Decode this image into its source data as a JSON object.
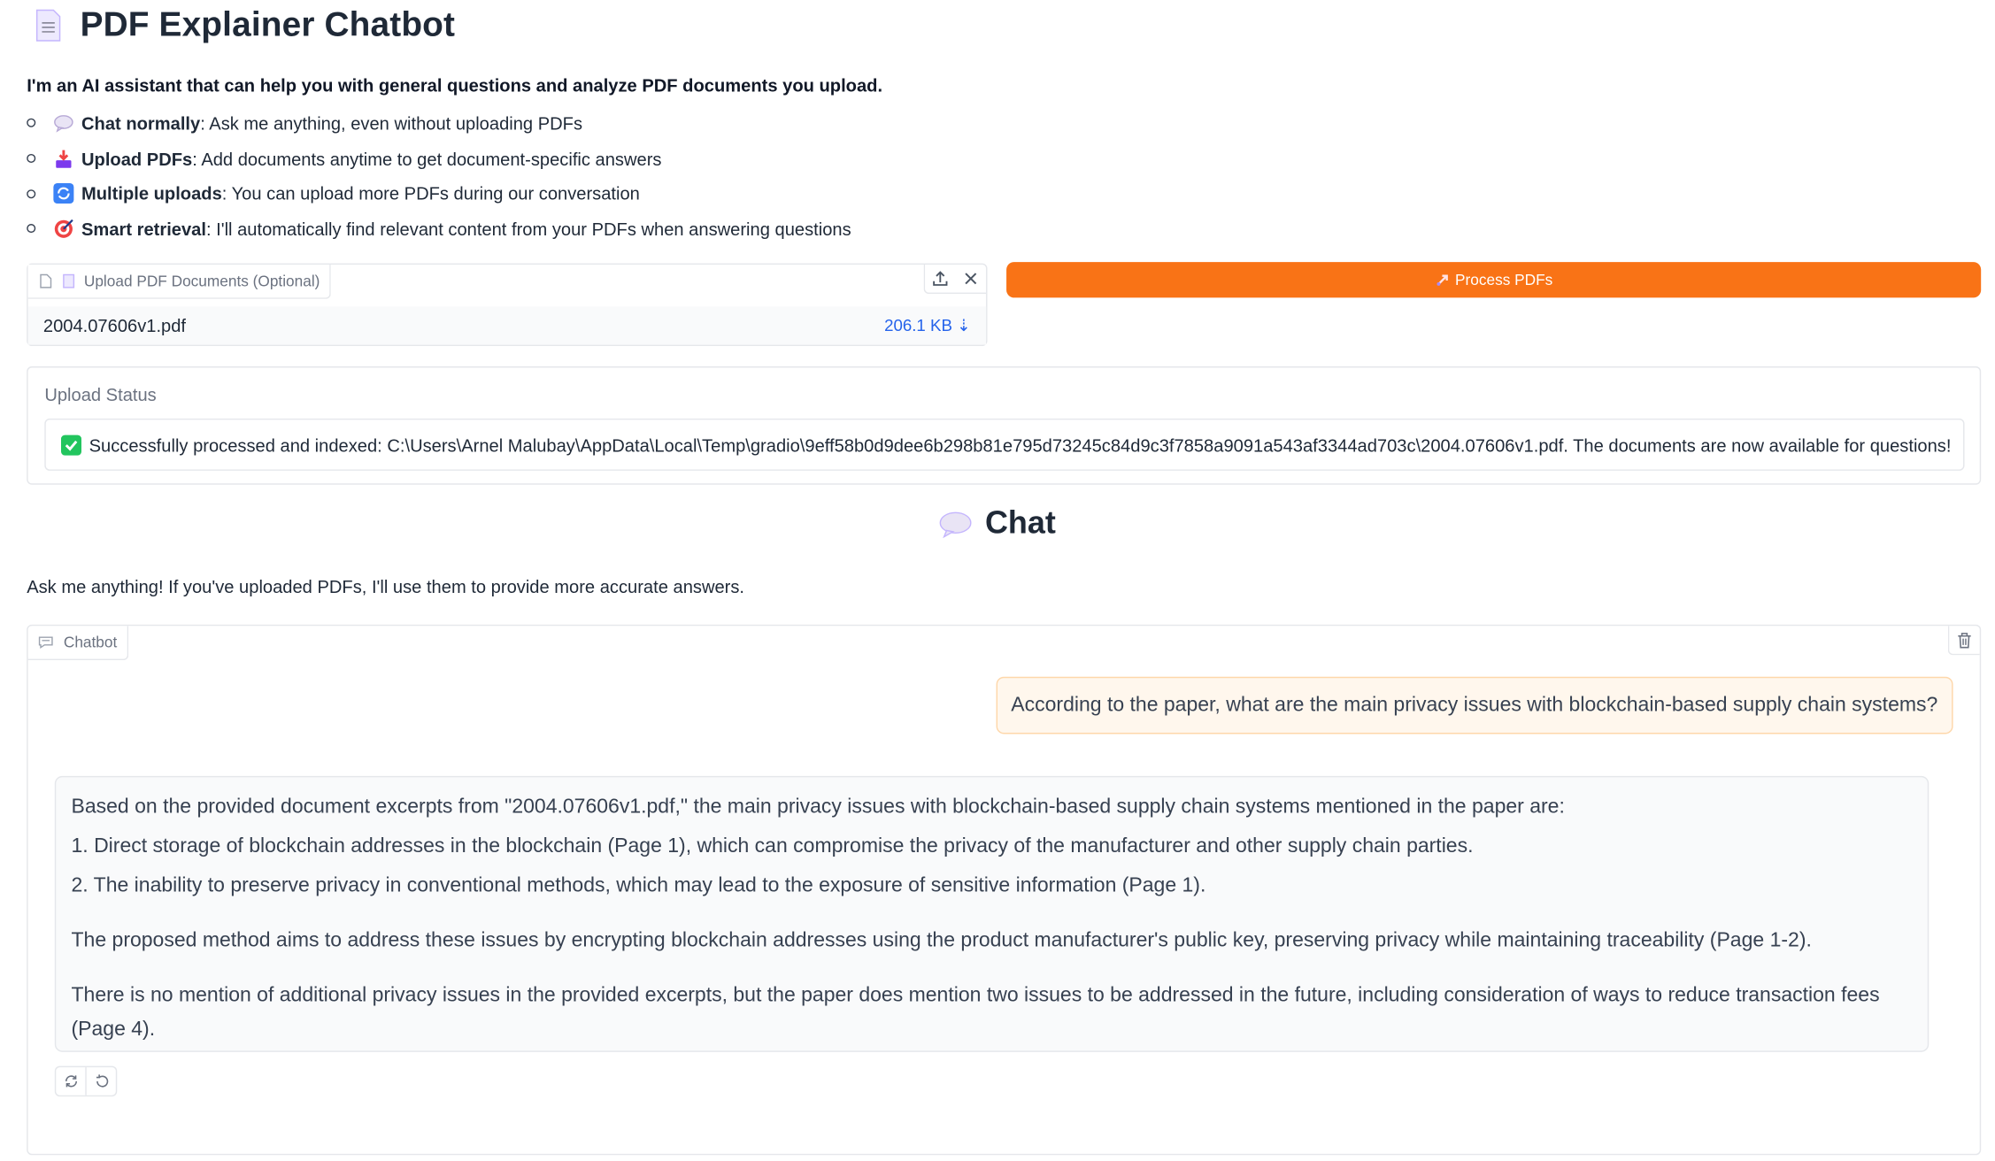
{
  "header": {
    "title": "PDF Explainer Chatbot",
    "icon": "document-icon"
  },
  "intro": "I'm an AI assistant that can help you with general questions and analyze PDF documents you upload.",
  "features": [
    {
      "icon": "speech-bubble-icon",
      "title": "Chat normally",
      "text": ": Ask me anything, even without uploading PDFs"
    },
    {
      "icon": "inbox-tray-icon",
      "title": "Upload PDFs",
      "text": ": Add documents anytime to get document-specific answers"
    },
    {
      "icon": "refresh-icon",
      "title": "Multiple uploads",
      "text": ": You can upload more PDFs during our conversation"
    },
    {
      "icon": "target-icon",
      "title": "Smart retrieval",
      "text": ": I'll automatically find relevant content from your PDFs when answering questions"
    }
  ],
  "upload": {
    "label": "Upload PDF Documents (Optional)",
    "file_name": "2004.07606v1.pdf",
    "file_size": "206.1 KB ⇣"
  },
  "process_button": {
    "label": "Process PDFs",
    "icon": "rocket-icon"
  },
  "status": {
    "label": "Upload Status",
    "message": "Successfully processed and indexed: C:\\Users\\Arnel Malubay\\AppData\\Local\\Temp\\gradio\\9eff58b0d9dee6b298b81e795d73245c84d9c3f7858a9091a543af3344ad703c\\2004.07606v1.pdf. The documents are now available for questions!"
  },
  "chat": {
    "heading": "Chat",
    "subtitle": "Ask me anything! If you've uploaded PDFs, I'll use them to provide more accurate answers.",
    "panel_label": "Chatbot",
    "user_message": "According to the paper, what are the main privacy issues with blockchain-based supply chain systems?",
    "bot_message": {
      "intro": "Based on the provided document excerpts from \"2004.07606v1.pdf,\" the main privacy issues with blockchain-based supply chain systems mentioned in the paper are:",
      "point1": "1. Direct storage of blockchain addresses in the blockchain (Page 1), which can compromise the privacy of the manufacturer and other supply chain parties.",
      "point2": "2. The inability to preserve privacy in conventional methods, which may lead to the exposure of sensitive information (Page 1).",
      "para2": "The proposed method aims to address these issues by encrypting blockchain addresses using the product manufacturer's public key, preserving privacy while maintaining traceability (Page 1-2).",
      "para3": "There is no mention of additional privacy issues in the provided excerpts, but the paper does mention two issues to be addressed in the future, including consideration of ways to reduce transaction fees (Page 4)."
    }
  },
  "colors": {
    "accent": "#f97316",
    "link": "#2563eb",
    "success": "#22c55e"
  }
}
